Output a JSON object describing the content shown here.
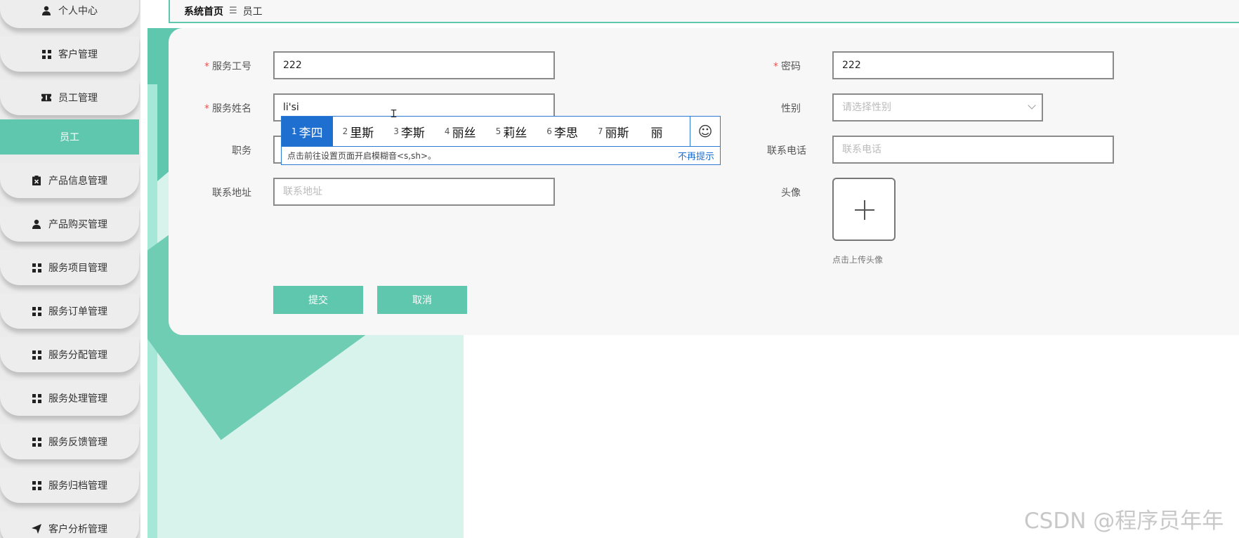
{
  "breadcrumb": {
    "home": "系统首页",
    "separator": "☰",
    "current": "员工"
  },
  "sidebar": {
    "items": [
      {
        "label": "个人中心",
        "icon": "user-icon"
      },
      {
        "label": "客户管理",
        "icon": "grid-icon"
      },
      {
        "label": "员工管理",
        "icon": "ticket-icon"
      },
      {
        "label": "员工",
        "icon": "",
        "active": true
      },
      {
        "label": "产品信息管理",
        "icon": "clipboard-icon"
      },
      {
        "label": "产品购买管理",
        "icon": "user-icon"
      },
      {
        "label": "服务项目管理",
        "icon": "grid-icon"
      },
      {
        "label": "服务订单管理",
        "icon": "grid-icon"
      },
      {
        "label": "服务分配管理",
        "icon": "grid-icon"
      },
      {
        "label": "服务处理管理",
        "icon": "grid-icon"
      },
      {
        "label": "服务反馈管理",
        "icon": "grid-icon"
      },
      {
        "label": "服务归档管理",
        "icon": "grid-icon"
      },
      {
        "label": "客户分析管理",
        "icon": "send-icon"
      }
    ]
  },
  "form": {
    "employee_no": {
      "label": "服务工号",
      "value": "222",
      "required": true
    },
    "password": {
      "label": "密码",
      "value": "222",
      "required": true
    },
    "employee_name": {
      "label": "服务姓名",
      "value": "li'si",
      "required": true
    },
    "gender": {
      "label": "性别",
      "placeholder": "请选择性别"
    },
    "position": {
      "label": "职务",
      "placeholder": ""
    },
    "phone": {
      "label": "联系电话",
      "placeholder": "联系电话"
    },
    "address": {
      "label": "联系地址",
      "placeholder": "联系地址"
    },
    "avatar": {
      "label": "头像",
      "hint": "点击上传头像"
    },
    "submit_label": "提交",
    "cancel_label": "取消"
  },
  "ime": {
    "candidates": [
      {
        "n": "1",
        "text": "李四"
      },
      {
        "n": "2",
        "text": "里斯"
      },
      {
        "n": "3",
        "text": "李斯"
      },
      {
        "n": "4",
        "text": "丽丝"
      },
      {
        "n": "5",
        "text": "莉丝"
      },
      {
        "n": "6",
        "text": "李思"
      },
      {
        "n": "7",
        "text": "丽斯"
      },
      {
        "n": "",
        "text": "丽"
      }
    ],
    "emoji": "☺",
    "tip": "点击前往设置页面开启模糊音<s,sh>。",
    "dismiss": "不再提示"
  },
  "watermark": "CSDN @程序员年年",
  "colors": {
    "accent": "#5fc7ad",
    "ime_blue": "#1e6fd0",
    "required": "#e45656"
  }
}
